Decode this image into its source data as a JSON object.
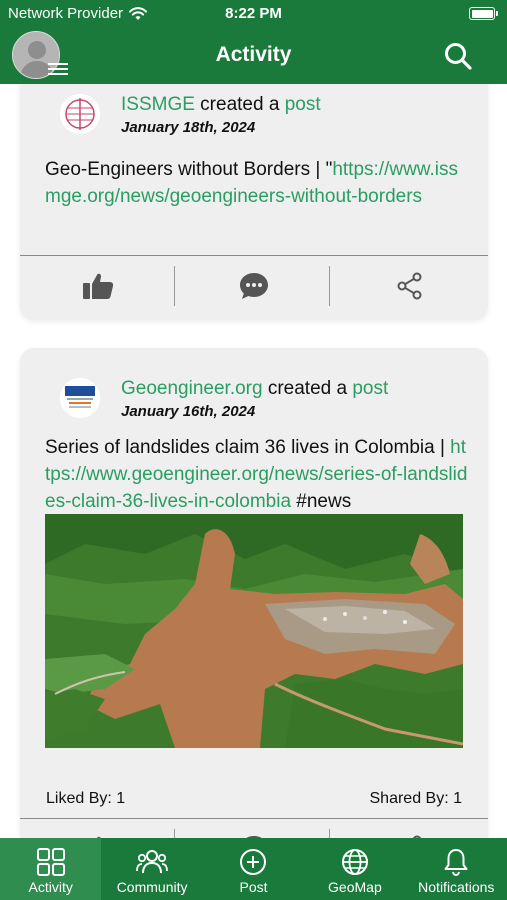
{
  "status": {
    "carrier": "Network Provider",
    "time": "8:22 PM",
    "wifi_icon": "wifi-icon",
    "battery_icon": "battery-icon"
  },
  "header": {
    "title": "Activity",
    "avatar_icon": "user-avatar-icon",
    "menu_icon": "hamburger-icon",
    "search_icon": "search-icon"
  },
  "posts": [
    {
      "author": "ISSMGE",
      "action_text": " created a ",
      "object_text": "post",
      "date": "January 18th, 2024",
      "text_before": "Geo-Engineers without Borders | \"",
      "link": "https://www.issmge.org/news/geoengineers-without-borders",
      "text_after": "",
      "logo_icon": "issmge-logo"
    },
    {
      "author": "Geoengineer.org",
      "action_text": " created a ",
      "object_text": "post",
      "date": "January 16th, 2024",
      "text_before": "Series of landslides claim 36 lives in Colombia | ",
      "link": "https://www.geoengineer.org/news/series-of-landslides-claim-36-lives-in-colombia",
      "text_after": " #news",
      "logo_icon": "geoengineer-logo",
      "image_desc": "landslide-aerial-photo",
      "liked_by": "Liked By: 1",
      "shared_by": "Shared By: 1"
    }
  ],
  "actions": {
    "like_icon": "thumbs-up-icon",
    "comment_icon": "comment-icon",
    "share_icon": "share-icon"
  },
  "tabs": [
    {
      "label": "Activity",
      "icon": "activity-grid-icon",
      "active": true
    },
    {
      "label": "Community",
      "icon": "community-icon",
      "active": false
    },
    {
      "label": "Post",
      "icon": "plus-circle-icon",
      "active": false
    },
    {
      "label": "GeoMap",
      "icon": "globe-icon",
      "active": false
    },
    {
      "label": "Notifications",
      "icon": "bell-icon",
      "active": false
    }
  ],
  "colors": {
    "brand_green": "#1a7a3c",
    "link_green": "#2a9d62",
    "card_bg": "#efefef"
  }
}
